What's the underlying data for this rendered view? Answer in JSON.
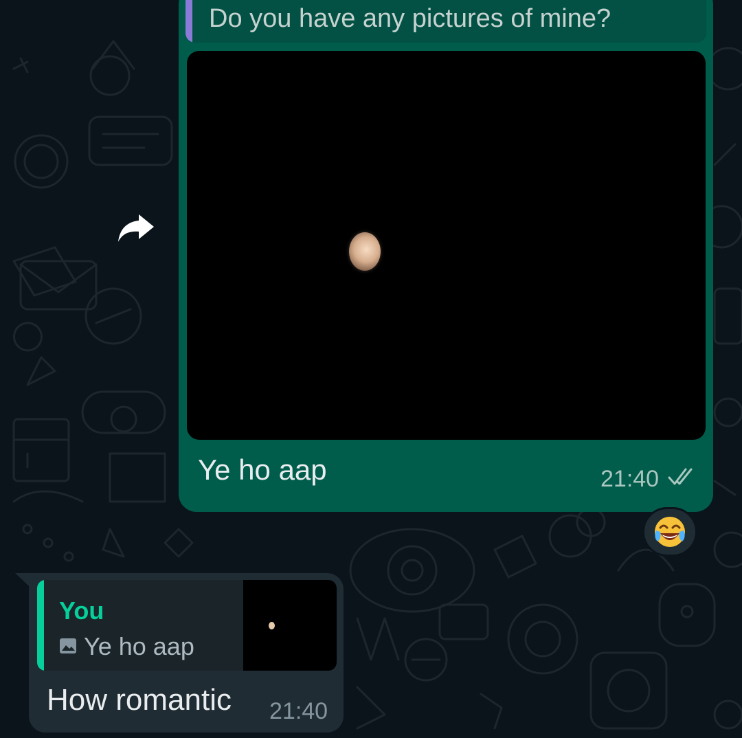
{
  "outgoing_message": {
    "quoted_text": "Do you have any pictures of mine?",
    "caption": "Ye ho aap",
    "time": "21:40",
    "status": "read",
    "reaction_emoji": "face-with-tears-of-joy"
  },
  "incoming_message": {
    "quoted_sender": "You",
    "quoted_text": "Ye ho aap",
    "text": "How romantic",
    "time": "21:40"
  },
  "colors": {
    "background": "#0b141a",
    "outgoing_bubble": "#005c4b",
    "incoming_bubble": "#202c33",
    "quote_accent_out": "#8b7bd8",
    "quote_accent_in": "#06cf9c"
  }
}
